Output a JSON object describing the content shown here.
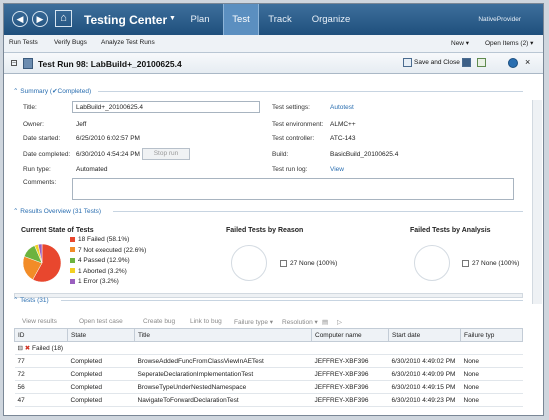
{
  "app": {
    "title": "Testing Center",
    "provider": "NativeProvider"
  },
  "nav": {
    "tabs": [
      {
        "label": "Plan"
      },
      {
        "label": "Test"
      },
      {
        "label": "Track"
      },
      {
        "label": "Organize"
      }
    ],
    "active": "Test"
  },
  "subnav": {
    "left": [
      "Run Tests",
      "Verify Bugs",
      "Analyze Test Runs"
    ],
    "new_label": "New ▾",
    "open_items": "Open Items (2) ▾"
  },
  "doc": {
    "title": "Test Run 98: LabBuild+_20100625.4",
    "save_close": "Save and Close"
  },
  "summary": {
    "section_label": "Summary",
    "completed_status": "Completed",
    "fields": {
      "title_label": "Title:",
      "title_value": "LabBuild+_20100625.4",
      "owner_label": "Owner:",
      "owner_value": "Jeff",
      "started_label": "Date started:",
      "started_value": "6/25/2010 6:02:57 PM",
      "completed_label": "Date completed:",
      "completed_value": "6/30/2010 4:54:24 PM",
      "stop_run": "Stop run",
      "runtype_label": "Run type:",
      "runtype_value": "Automated",
      "comments_label": "Comments:",
      "settings_label": "Test settings:",
      "settings_value": "Autotest",
      "environment_label": "Test environment:",
      "environment_value": "ALMC++",
      "controller_label": "Test controller:",
      "controller_value": "ATC-143",
      "build_label": "Build:",
      "build_value": "BasicBuild_20100625.4",
      "log_label": "Test run log:",
      "log_value": "View"
    }
  },
  "results": {
    "section_label": "Results Overview",
    "count_label": "(31 Tests)",
    "current_state_heading": "Current State of Tests",
    "failed_reason_heading": "Failed Tests by Reason",
    "failed_analysis_heading": "Failed Tests by Analysis",
    "reason_item": "27 None (100%)",
    "analysis_item": "27 None (100%)"
  },
  "chart_data": {
    "type": "pie",
    "title": "Current State of Tests",
    "categories": [
      "Failed",
      "Not executed",
      "Passed",
      "Aborted",
      "Error"
    ],
    "values": [
      18,
      7,
      4,
      1,
      1
    ],
    "labels": [
      "18 Failed (58.1%)",
      "7 Not executed (22.6%)",
      "4 Passed (12.9%)",
      "1 Aborted (3.2%)",
      "1 Error (3.2%)"
    ],
    "colors": [
      "#e8472e",
      "#f28c28",
      "#6cb33f",
      "#f2d024",
      "#9a5fbf"
    ]
  },
  "tests": {
    "section_label": "Tests",
    "count_label": "(31)",
    "toolbar": [
      "View results",
      "Open test case",
      "Create bug",
      "Link to bug",
      "Failure type ▾",
      "Resolution ▾"
    ],
    "columns": [
      "ID",
      "State",
      "Title",
      "Computer name",
      "Start date",
      "Failure typ"
    ],
    "group_label": "Failed (18)",
    "rows": [
      {
        "id": "77",
        "state": "Completed",
        "title": "BrowseAddedFuncFromClassViewInAETest",
        "computer": "JEFFREY-XBF396",
        "start": "6/30/2010 4:49:02 PM",
        "failure": "None"
      },
      {
        "id": "72",
        "state": "Completed",
        "title": "SeperateDeclarationImplementationTest",
        "computer": "JEFFREY-XBF396",
        "start": "6/30/2010 4:49:09 PM",
        "failure": "None"
      },
      {
        "id": "56",
        "state": "Completed",
        "title": "BrowseTypeUnderNestedNamespace",
        "computer": "JEFFREY-XBF396",
        "start": "6/30/2010 4:49:15 PM",
        "failure": "None"
      },
      {
        "id": "47",
        "state": "Completed",
        "title": "NavigateToForwardDeclarationTest",
        "computer": "JEFFREY-XBF396",
        "start": "6/30/2010 4:49:23 PM",
        "failure": "None"
      }
    ]
  }
}
